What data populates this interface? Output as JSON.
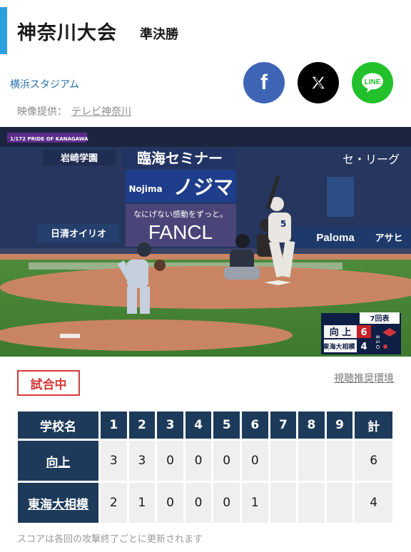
{
  "header": {
    "title": "神奈川大会",
    "round": "準決勝"
  },
  "venue": "横浜スタジアム",
  "provider": {
    "label": "映像提供：",
    "name": "テレビ神奈川"
  },
  "share": {
    "facebook": "f",
    "line": "LINE"
  },
  "video": {
    "corner_label": "1/172 PRIDE OF KANAGAWA",
    "ads": [
      "岩崎学園",
      "臨海セミナー",
      "ノジマ",
      "Nojima",
      "なにげない感動をずっと。",
      "FANCL",
      "日清オイリオ",
      "Paloma",
      "アサヒ",
      "セ・リーグ"
    ],
    "batter_number": "5",
    "overlay": {
      "inning": "7回表",
      "bso": "B S O",
      "teams": [
        {
          "name": "向 上",
          "score": "6"
        },
        {
          "name": "東海大相模",
          "score": "4"
        }
      ]
    }
  },
  "status": "試合中",
  "viewing_env_link": "視聴推奨環境",
  "scoreboard": {
    "header": [
      "学校名",
      "1",
      "2",
      "3",
      "4",
      "5",
      "6",
      "7",
      "8",
      "9",
      "計"
    ],
    "rows": [
      {
        "team": "向上",
        "innings": [
          "3",
          "3",
          "0",
          "0",
          "0",
          "0",
          "",
          "",
          ""
        ],
        "total": "6"
      },
      {
        "team": "東海大相模",
        "innings": [
          "2",
          "1",
          "0",
          "0",
          "0",
          "1",
          "",
          "",
          ""
        ],
        "total": "4"
      }
    ]
  },
  "note": "スコアは各回の攻撃終了ごとに更新されます",
  "colors": {
    "accent": "#2aa0dc",
    "table_header": "#1d3a5a",
    "status": "#d63a3a",
    "facebook": "#3e65b5",
    "line": "#22c02a"
  }
}
